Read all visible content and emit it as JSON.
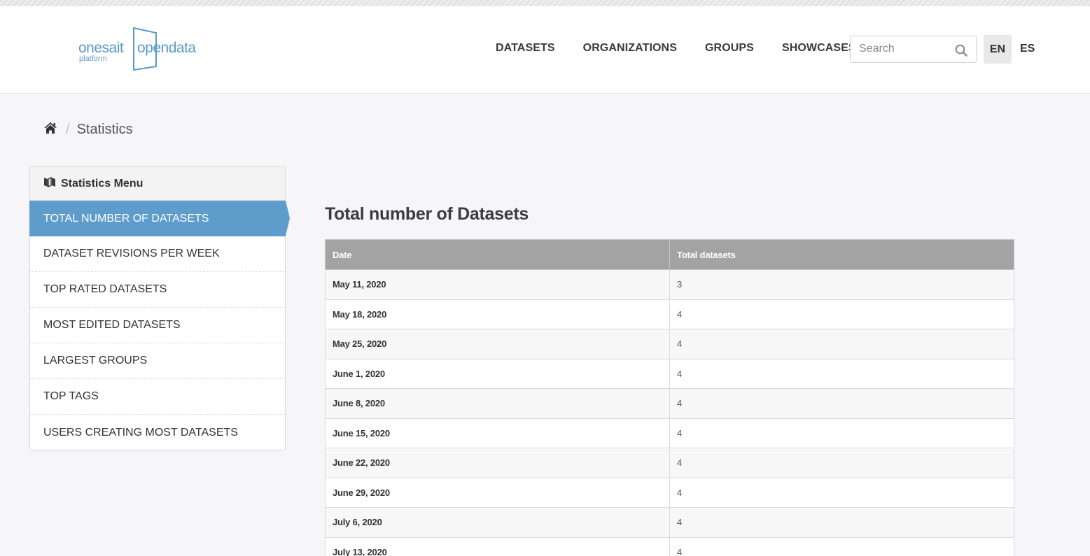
{
  "header": {
    "logo": {
      "word1": "onesait",
      "word2": "opendata",
      "sub": "platform"
    },
    "nav": [
      "DATASETS",
      "ORGANIZATIONS",
      "GROUPS",
      "SHOWCASES"
    ],
    "search": {
      "placeholder": "Search",
      "value": ""
    },
    "languages": {
      "active": "EN",
      "other": "ES"
    }
  },
  "breadcrumb": {
    "current": "Statistics"
  },
  "sidebar": {
    "title": "Statistics Menu",
    "items": [
      {
        "label": "TOTAL NUMBER OF DATASETS",
        "active": true
      },
      {
        "label": "DATASET REVISIONS PER WEEK"
      },
      {
        "label": "TOP RATED DATASETS"
      },
      {
        "label": "MOST EDITED DATASETS"
      },
      {
        "label": "LARGEST GROUPS"
      },
      {
        "label": "TOP TAGS"
      },
      {
        "label": "USERS CREATING MOST DATASETS"
      }
    ]
  },
  "main": {
    "title": "Total number of Datasets",
    "columns": [
      "Date",
      "Total datasets"
    ],
    "rows": [
      [
        "May 11, 2020",
        "3"
      ],
      [
        "May 18, 2020",
        "4"
      ],
      [
        "May 25, 2020",
        "4"
      ],
      [
        "June 1, 2020",
        "4"
      ],
      [
        "June 8, 2020",
        "4"
      ],
      [
        "June 15, 2020",
        "4"
      ],
      [
        "June 22, 2020",
        "4"
      ],
      [
        "June 29, 2020",
        "4"
      ],
      [
        "July 6, 2020",
        "4"
      ],
      [
        "July 13, 2020",
        "4"
      ]
    ]
  },
  "colors": {
    "accent": "#5e9ccc",
    "logo": "#5b9ac8",
    "table_header": "#a3a3a3"
  }
}
